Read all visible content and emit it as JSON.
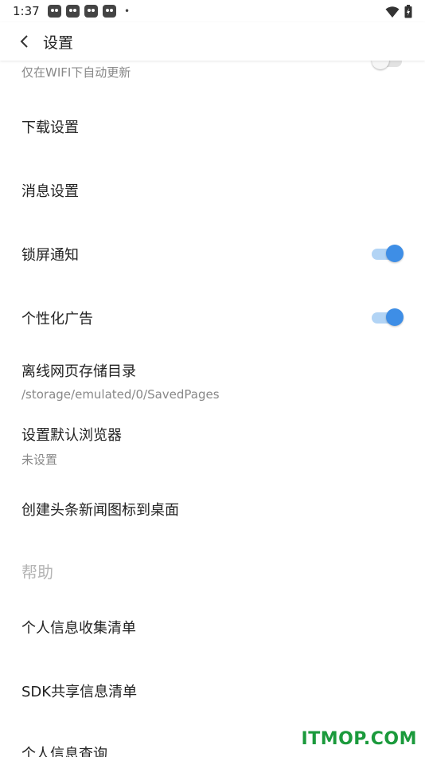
{
  "status_bar": {
    "time": "1:37",
    "notification_icons": [
      "notification-icon",
      "notification-icon",
      "notification-icon",
      "notification-icon"
    ],
    "more_dot": "•"
  },
  "app_bar": {
    "title": "设置"
  },
  "settings": {
    "partial_toggle": {
      "subtitle": "仅在WIFI下自动更新",
      "enabled": false
    },
    "download": "下载设置",
    "message": "消息设置",
    "lock_screen": {
      "label": "锁屏通知",
      "enabled": true
    },
    "personalized_ads": {
      "label": "个性化广告",
      "enabled": true
    },
    "offline_dir": {
      "label": "离线网页存储目录",
      "value": "/storage/emulated/0/SavedPages"
    },
    "default_browser": {
      "label": "设置默认浏览器",
      "value": "未设置"
    },
    "create_shortcut": "创建头条新闻图标到桌面"
  },
  "help": {
    "section_title": "帮助",
    "items": [
      "个人信息收集清单",
      "SDK共享信息清单",
      "个人信息查询"
    ]
  },
  "watermark": "ITMOP.COM",
  "colors": {
    "accent": "#3e8ee6",
    "accent_track": "#b2d4f5",
    "watermark": "#1b9a3c"
  }
}
